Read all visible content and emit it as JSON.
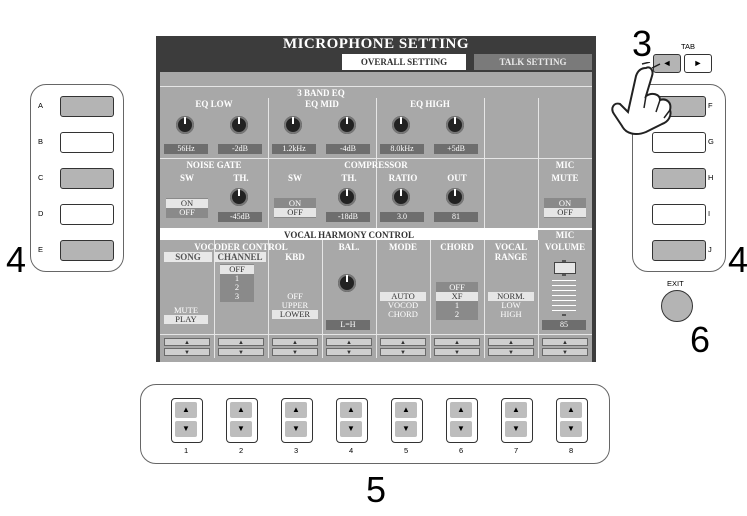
{
  "callouts": {
    "left_num": "4",
    "right_num": "4",
    "tab_num": "3",
    "bottom_num": "5",
    "exit_num": "6"
  },
  "left_buttons": [
    {
      "label": "A",
      "shade": "gray"
    },
    {
      "label": "B",
      "shade": "white"
    },
    {
      "label": "C",
      "shade": "gray"
    },
    {
      "label": "D",
      "shade": "white"
    },
    {
      "label": "E",
      "shade": "gray"
    }
  ],
  "right_buttons": [
    {
      "label": "F",
      "shade": "gray"
    },
    {
      "label": "G",
      "shade": "white"
    },
    {
      "label": "H",
      "shade": "gray"
    },
    {
      "label": "I",
      "shade": "white"
    },
    {
      "label": "J",
      "shade": "gray"
    }
  ],
  "tab_label": "TAB",
  "tab_left": "◄",
  "tab_right": "►",
  "exit_label": "EXIT",
  "screen": {
    "title": "MICROPHONE SETTING",
    "tabs": [
      {
        "label": "OVERALL SETTING",
        "active": true
      },
      {
        "label": "TALK SETTING",
        "active": false
      }
    ],
    "eq_title": "3 BAND EQ",
    "eq": {
      "low": {
        "label": "EQ LOW",
        "freq": "56Hz",
        "gain": "-2dB"
      },
      "mid": {
        "label": "EQ MID",
        "freq": "1.2kHz",
        "gain": "-4dB"
      },
      "high": {
        "label": "EQ HIGH",
        "freq": "8.0kHz",
        "gain": "+5dB"
      }
    },
    "noise_gate": {
      "label": "NOISE GATE",
      "sw_label": "SW",
      "sw_on": "ON",
      "sw_off": "OFF",
      "th_label": "TH.",
      "th_value": "-45dB"
    },
    "compressor": {
      "label": "COMPRESSOR",
      "sw_label": "SW",
      "sw_on": "ON",
      "sw_off": "OFF",
      "th_label": "TH.",
      "th_value": "-18dB",
      "ratio_label": "RATIO",
      "ratio_value": "3.0",
      "out_label": "OUT",
      "out_value": "81"
    },
    "mic_mute": {
      "label": "MIC",
      "sub": "MUTE",
      "on": "ON",
      "off": "OFF"
    },
    "vhc_title": "VOCAL HARMONY CONTROL",
    "vocoder_control": "VOCODER CONTROL",
    "song": {
      "label": "SONG",
      "options": [
        "MUTE",
        "PLAY"
      ]
    },
    "channel": {
      "label": "CHANNEL",
      "options": [
        "OFF",
        "1",
        "2",
        "3"
      ]
    },
    "kbd": {
      "label": "KBD",
      "options": [
        "OFF",
        "UPPER",
        "LOWER"
      ]
    },
    "bal": {
      "label": "BAL.",
      "value": "L=H"
    },
    "mode": {
      "label": "MODE",
      "options": [
        "AUTO",
        "VOCOD",
        "CHORD"
      ]
    },
    "chord": {
      "label": "CHORD",
      "options": [
        "OFF",
        "XF",
        "1",
        "2"
      ]
    },
    "vocal_range": {
      "label1": "VOCAL",
      "label2": "RANGE",
      "options": [
        "NORM.",
        "LOW",
        "HIGH"
      ]
    },
    "mic_volume": {
      "label": "MIC",
      "sub": "VOLUME",
      "value": "85"
    }
  },
  "bottom_buttons": [
    {
      "num": "1",
      "up": "▲",
      "down": "▼"
    },
    {
      "num": "2",
      "up": "▲",
      "down": "▼"
    },
    {
      "num": "3",
      "up": "▲",
      "down": "▼"
    },
    {
      "num": "4",
      "up": "▲",
      "down": "▼"
    },
    {
      "num": "5",
      "up": "▲",
      "down": "▼"
    },
    {
      "num": "6",
      "up": "▲",
      "down": "▼"
    },
    {
      "num": "7",
      "up": "▲",
      "down": "▼"
    },
    {
      "num": "8",
      "up": "▲",
      "down": "▼"
    }
  ],
  "colors": {
    "panel_gray": "#a8a8a8",
    "screen_dark": "#3c3c3c",
    "button_gray": "#b4b4b4"
  }
}
